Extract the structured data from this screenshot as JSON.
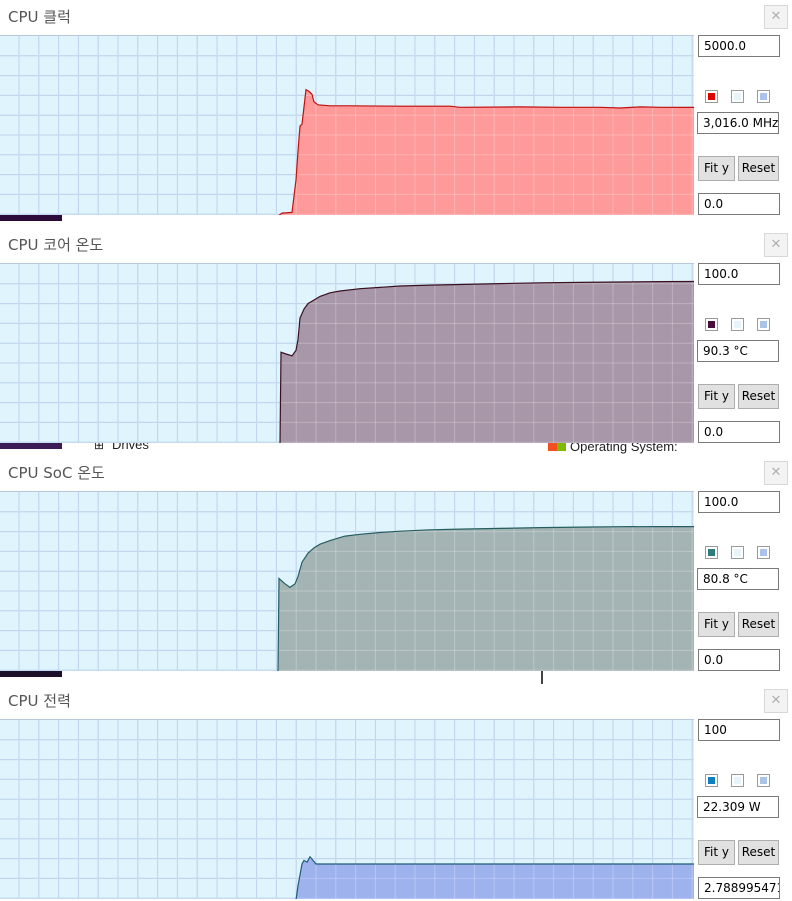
{
  "panels": [
    {
      "title": "CPU 클럭",
      "max": "5000.0",
      "value": "3,016.0 MHz",
      "min": "0.0",
      "fit_label": "Fit y",
      "reset_label": "Reset",
      "swatches": [
        "#e00000",
        "#e8f4fb",
        "#a9c4e8"
      ],
      "line_color": "#c01010",
      "fill_color": "#ff9a9a",
      "y_max": 5000,
      "series": [
        [
          0,
          0
        ],
        [
          278,
          0
        ],
        [
          282,
          80
        ],
        [
          292,
          100
        ],
        [
          296,
          1000
        ],
        [
          298,
          1800
        ],
        [
          300,
          2500
        ],
        [
          302,
          2550
        ],
        [
          306,
          3510
        ],
        [
          309,
          3460
        ],
        [
          312,
          3380
        ],
        [
          314,
          3170
        ],
        [
          318,
          3090
        ],
        [
          330,
          3060
        ],
        [
          350,
          3060
        ],
        [
          400,
          3050
        ],
        [
          450,
          3050
        ],
        [
          460,
          3020
        ],
        [
          520,
          3030
        ],
        [
          560,
          3020
        ],
        [
          600,
          3020
        ],
        [
          620,
          3000
        ],
        [
          640,
          3030
        ],
        [
          660,
          3020
        ],
        [
          690,
          3016
        ],
        [
          694,
          3016
        ]
      ]
    },
    {
      "title": "CPU 코어 온도",
      "max": "100.0",
      "value": "90.3 °C",
      "min": "0.0",
      "fit_label": "Fit y",
      "reset_label": "Reset",
      "swatches": [
        "#4a0e3e",
        "#e8f4fb",
        "#a9c4e8"
      ],
      "line_color": "#3a1020",
      "fill_color": "#a797a8",
      "y_max": 100,
      "series": [
        [
          0,
          0
        ],
        [
          280,
          0
        ],
        [
          281,
          51
        ],
        [
          286,
          50
        ],
        [
          292,
          49
        ],
        [
          296,
          52
        ],
        [
          298,
          58
        ],
        [
          300,
          70
        ],
        [
          304,
          75
        ],
        [
          308,
          78
        ],
        [
          314,
          80
        ],
        [
          320,
          82
        ],
        [
          330,
          84
        ],
        [
          340,
          85
        ],
        [
          360,
          86.3
        ],
        [
          380,
          87
        ],
        [
          400,
          87.8
        ],
        [
          430,
          88.3
        ],
        [
          460,
          88.6
        ],
        [
          500,
          89.1
        ],
        [
          540,
          89.5
        ],
        [
          580,
          89.8
        ],
        [
          620,
          90
        ],
        [
          660,
          90.2
        ],
        [
          690,
          90.3
        ],
        [
          694,
          90.3
        ]
      ]
    },
    {
      "title": "CPU SoC 온도",
      "max": "100.0",
      "value": "80.8 °C",
      "min": "0.0",
      "fit_label": "Fit y",
      "reset_label": "Reset",
      "swatches": [
        "#2f7c7c",
        "#e8f4fb",
        "#a9c4e8"
      ],
      "line_color": "#255e60",
      "fill_color": "#a4b4b4",
      "y_max": 100,
      "series": [
        [
          0,
          0
        ],
        [
          278,
          0
        ],
        [
          279,
          52
        ],
        [
          285,
          49
        ],
        [
          290,
          47
        ],
        [
          295,
          49
        ],
        [
          298,
          53
        ],
        [
          302,
          61
        ],
        [
          308,
          66
        ],
        [
          314,
          69
        ],
        [
          320,
          71
        ],
        [
          330,
          73
        ],
        [
          345,
          75.5
        ],
        [
          360,
          76.5
        ],
        [
          380,
          77.5
        ],
        [
          400,
          78.2
        ],
        [
          430,
          79
        ],
        [
          460,
          79.4
        ],
        [
          500,
          79.8
        ],
        [
          540,
          80.2
        ],
        [
          580,
          80.5
        ],
        [
          620,
          80.7
        ],
        [
          660,
          80.8
        ],
        [
          694,
          80.8
        ]
      ]
    },
    {
      "title": "CPU 전력",
      "max": "100",
      "value": "22.309 W",
      "min": "2.788995471",
      "fit_label": "Fit y",
      "reset_label": "Reset",
      "swatches": [
        "#0f7fc0",
        "#e8f4fb",
        "#a9c4e8"
      ],
      "line_color": "#1d5c7a",
      "fill_color": "#9eb2ee",
      "y_max": 100,
      "series": [
        [
          0,
          0
        ],
        [
          296,
          0
        ],
        [
          298,
          8
        ],
        [
          300,
          14
        ],
        [
          302,
          20
        ],
        [
          304,
          22
        ],
        [
          307,
          21
        ],
        [
          310,
          24
        ],
        [
          313,
          22
        ],
        [
          316,
          20
        ],
        [
          320,
          20
        ],
        [
          400,
          20
        ],
        [
          500,
          20
        ],
        [
          600,
          20
        ],
        [
          694,
          20
        ]
      ]
    }
  ],
  "background_fragments": {
    "drives_label": "Drives",
    "os_label": "Operating System:"
  }
}
